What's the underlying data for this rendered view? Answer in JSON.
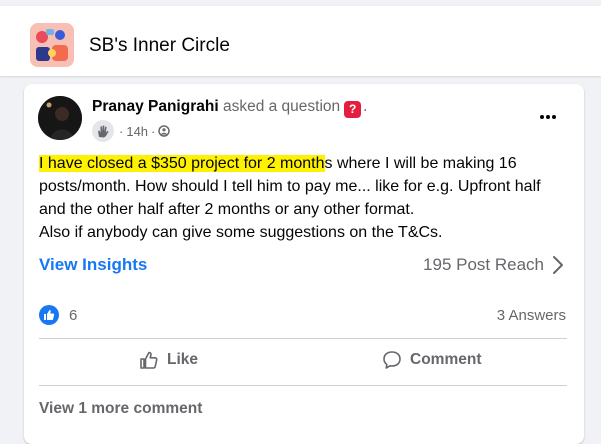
{
  "group": {
    "name": "SB's Inner Circle",
    "icon": "group-cover-image"
  },
  "post": {
    "author": "Pranay Panigrahi",
    "action": "asked a question",
    "action_suffix": ".",
    "question_icon": "?",
    "time": "14h",
    "separator": "·",
    "audience_icon": "public-group-icon",
    "text_highlighted": "I have closed a $350 project for 2 month",
    "text_rest": "s where I will be making 16 posts/month. How should I tell him to pay me... like for e.g. Upfront half and the other half after 2 months or any other format.",
    "text_line2": "Also if anybody can give some suggestions on the T&Cs.",
    "highlight_color": "#fff200"
  },
  "insights": {
    "label": "View Insights",
    "reach": "195 Post Reach"
  },
  "stats": {
    "likes": "6",
    "answers": "3 Answers"
  },
  "actions": {
    "like": "Like",
    "comment": "Comment"
  },
  "footer": {
    "view_more": "View 1 more comment"
  },
  "colors": {
    "accent": "#1877f2",
    "text": "#050505",
    "secondary": "#65676b",
    "background": "#f0f2f5"
  }
}
